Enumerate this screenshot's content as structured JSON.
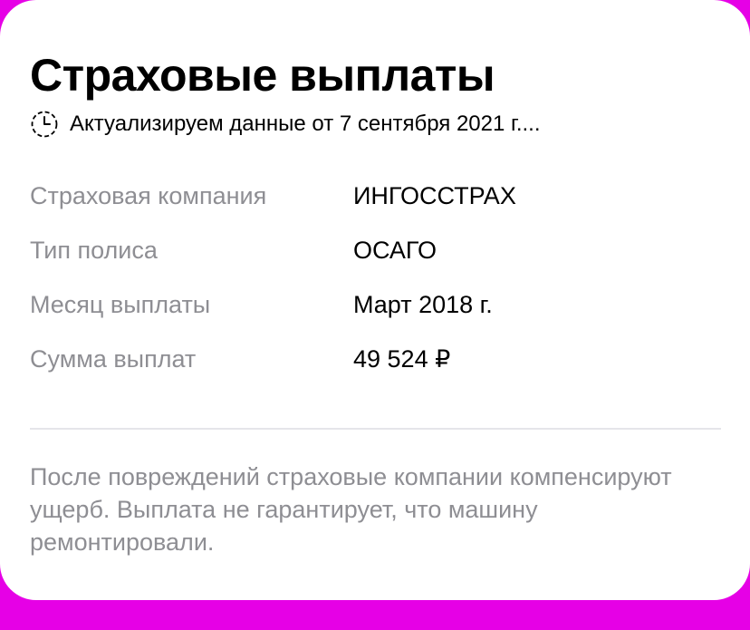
{
  "card": {
    "title": "Страховые выплаты",
    "status": {
      "icon": "clock-icon",
      "text": "Актуализируем данные от 7 сентября 2021 г...."
    },
    "rows": [
      {
        "label": "Страховая компания",
        "value": "ИНГОССТРАХ"
      },
      {
        "label": "Тип полиса",
        "value": "ОСАГО"
      },
      {
        "label": "Месяц выплаты",
        "value": "Март 2018 г."
      },
      {
        "label": "Сумма выплат",
        "value": "49 524 ₽"
      }
    ],
    "note": "После повреждений страховые компании компенсируют ущерб. Выплата не гарантирует, что машину ремонтировали."
  },
  "colors": {
    "background": "#e600e6",
    "card": "#ffffff",
    "label": "#8e8e93",
    "value": "#000000",
    "divider": "#e5e5ea"
  }
}
